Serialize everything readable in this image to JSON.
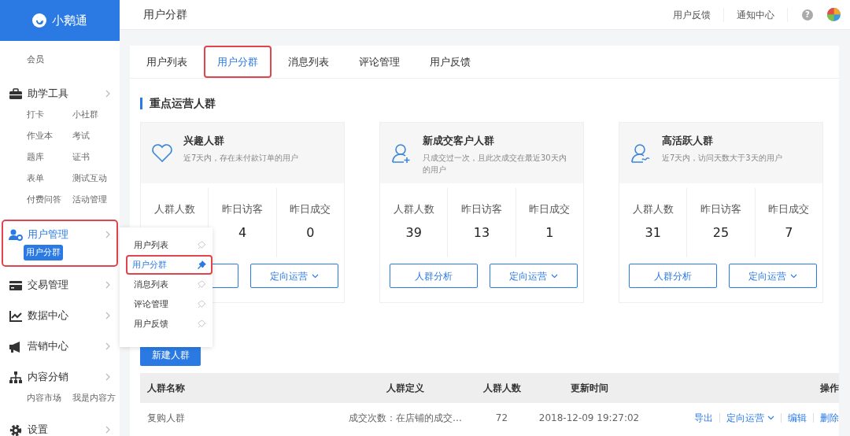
{
  "brand": {
    "name": "小鹅通"
  },
  "sidebar": {
    "items": [
      {
        "kind": "link",
        "label": "会员"
      },
      {
        "kind": "group",
        "label": "助学工具",
        "selected": false,
        "annotated": false,
        "children": [
          {
            "label": "打卡",
            "selected": false
          },
          {
            "label": "小社群",
            "selected": false
          },
          {
            "label": "作业本",
            "selected": false
          },
          {
            "label": "考试",
            "selected": false
          },
          {
            "label": "题库",
            "selected": false
          },
          {
            "label": "证书",
            "selected": false
          },
          {
            "label": "表单",
            "selected": false
          },
          {
            "label": "测试互动",
            "selected": false
          },
          {
            "label": "付费问答",
            "selected": false
          },
          {
            "label": "活动管理",
            "selected": false
          }
        ]
      },
      {
        "kind": "group",
        "label": "用户管理",
        "selected": true,
        "annotated": true,
        "children": [
          {
            "label": "用户分群",
            "selected": true
          }
        ]
      },
      {
        "kind": "group",
        "label": "交易管理",
        "selected": false,
        "annotated": false
      },
      {
        "kind": "group",
        "label": "数据中心",
        "selected": false,
        "annotated": false
      },
      {
        "kind": "group",
        "label": "营销中心",
        "selected": false,
        "annotated": false
      },
      {
        "kind": "group",
        "label": "内容分销",
        "selected": false,
        "annotated": false,
        "children": [
          {
            "label": "内容市场",
            "selected": false
          },
          {
            "label": "我是内容方",
            "selected": false
          }
        ]
      },
      {
        "kind": "group",
        "label": "设置",
        "selected": false,
        "annotated": false
      }
    ]
  },
  "popup_menu": {
    "items": [
      {
        "label": "用户列表",
        "selected": false,
        "pinned": false,
        "annotated": false
      },
      {
        "label": "用户分群",
        "selected": true,
        "pinned": true,
        "annotated": true
      },
      {
        "label": "消息列表",
        "selected": false,
        "pinned": false,
        "annotated": false
      },
      {
        "label": "评论管理",
        "selected": false,
        "pinned": false,
        "annotated": false
      },
      {
        "label": "用户反馈",
        "selected": false,
        "pinned": false,
        "annotated": false
      }
    ]
  },
  "topbar": {
    "title": "用户分群",
    "links": [
      "用户反馈",
      "通知中心"
    ],
    "help": "?"
  },
  "tabs": [
    {
      "label": "用户列表",
      "selected": false,
      "annotated": false
    },
    {
      "label": "用户分群",
      "selected": true,
      "annotated": true
    },
    {
      "label": "消息列表",
      "selected": false,
      "annotated": false
    },
    {
      "label": "评论管理",
      "selected": false,
      "annotated": false
    },
    {
      "label": "用户反馈",
      "selected": false,
      "annotated": false
    }
  ],
  "section_title": "重点运营人群",
  "cards": [
    {
      "title": "兴趣人群",
      "description": "近7天内，存在未付款订单的用户",
      "stats": [
        {
          "label": "人群人数"
        },
        {
          "label": "昨日访客",
          "value": "4"
        },
        {
          "label": "昨日成交",
          "value": "0"
        }
      ],
      "buttons": [
        {
          "kind": "plain"
        },
        {
          "kind": "dropdown",
          "label": "定向运营"
        }
      ]
    },
    {
      "title": "新成交客户人群",
      "description": "只成交过一次，且此次成交在最近30天内的用户",
      "stats": [
        {
          "label": "人群人数",
          "value": "39"
        },
        {
          "label": "昨日访客",
          "value": "13"
        },
        {
          "label": "昨日成交",
          "value": "1"
        }
      ],
      "buttons": [
        {
          "kind": "plain",
          "label": "人群分析"
        },
        {
          "kind": "dropdown",
          "label": "定向运营"
        }
      ]
    },
    {
      "title": "高活跃人群",
      "description": "近7天内，访问天数大于3天的用户",
      "stats": [
        {
          "label": "人群人数",
          "value": "31"
        },
        {
          "label": "昨日访客",
          "value": "25"
        },
        {
          "label": "昨日成交",
          "value": "7"
        }
      ],
      "buttons": [
        {
          "kind": "plain",
          "label": "人群分析"
        },
        {
          "kind": "dropdown",
          "label": "定向运营"
        }
      ]
    }
  ],
  "new_button": "新建人群",
  "table": {
    "columns": [
      "人群名称",
      "人群定义",
      "人群人数",
      "更新时间",
      "操作"
    ],
    "rows": [
      {
        "cells": [
          "复购人群",
          "成交次数：在店铺的成交…",
          "72",
          "2018-12-09 19:27:02"
        ],
        "actions": [
          {
            "kind": "link",
            "label": "导出"
          },
          {
            "kind": "dropdown",
            "label": "定向运营"
          },
          {
            "kind": "link",
            "label": "编辑"
          },
          {
            "kind": "link",
            "label": "删除"
          }
        ]
      }
    ]
  }
}
